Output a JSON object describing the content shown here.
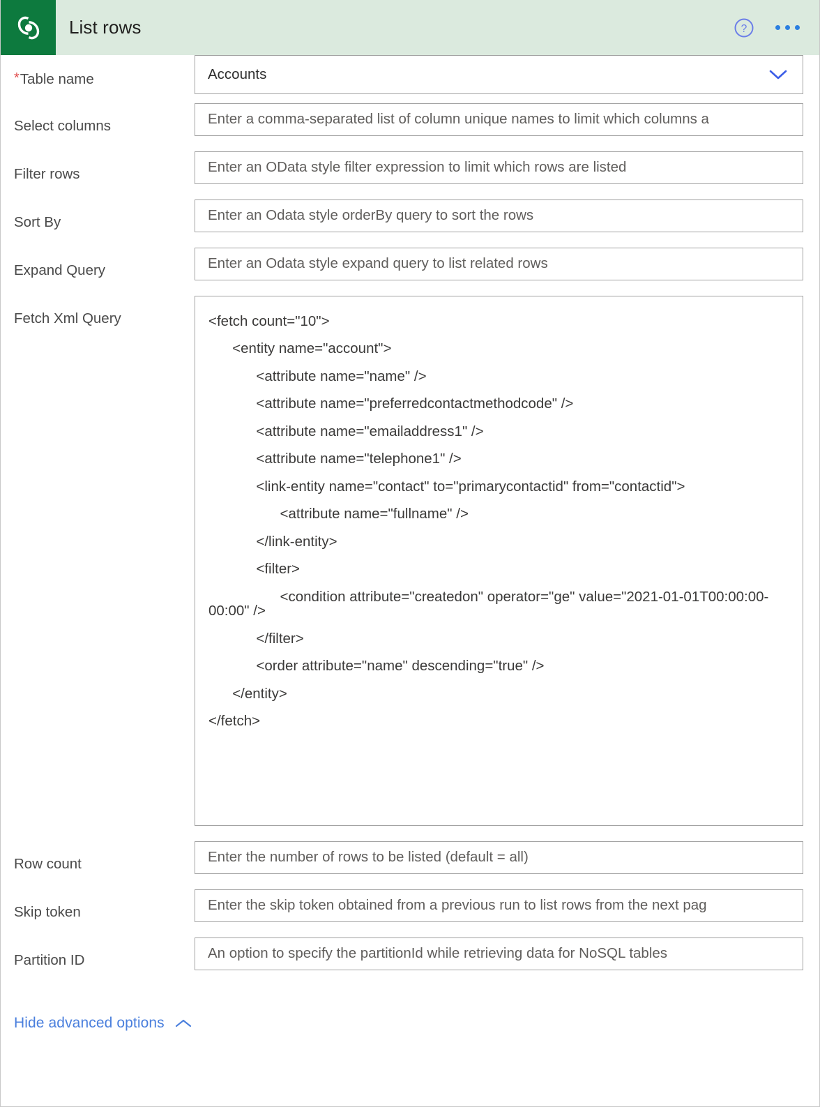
{
  "header": {
    "title": "List rows",
    "logo_name": "dataverse-logo",
    "logo_color": "#0d7a3e",
    "bar_color": "#dbeade",
    "help_label": "?",
    "accent_color": "#2b7fe0"
  },
  "form": {
    "fields": [
      {
        "label": "Table name",
        "required": true,
        "name": "table-name",
        "value": "Accounts",
        "placeholder": "",
        "control": "dropdown"
      },
      {
        "label": "Select columns",
        "required": false,
        "name": "select-columns",
        "value": "",
        "placeholder": "Enter a comma-separated list of column unique names to limit which columns a",
        "control": "text"
      },
      {
        "label": "Filter rows",
        "required": false,
        "name": "filter-rows",
        "value": "",
        "placeholder": "Enter an OData style filter expression to limit which rows are listed",
        "control": "text"
      },
      {
        "label": "Sort By",
        "required": false,
        "name": "sort-by",
        "value": "",
        "placeholder": "Enter an Odata style orderBy query to sort the rows",
        "control": "text"
      },
      {
        "label": "Expand Query",
        "required": false,
        "name": "expand-query",
        "value": "",
        "placeholder": "Enter an Odata style expand query to list related rows",
        "control": "text"
      },
      {
        "label": "Fetch Xml Query",
        "required": false,
        "name": "fetch-xml-query",
        "control": "multiline"
      },
      {
        "label": "Row count",
        "required": false,
        "name": "row-count",
        "value": "",
        "placeholder": "Enter the number of rows to be listed (default = all)",
        "control": "text"
      },
      {
        "label": "Skip token",
        "required": false,
        "name": "skip-token",
        "value": "",
        "placeholder": "Enter the skip token obtained from a previous run to list rows from the next pag",
        "control": "text"
      },
      {
        "label": "Partition ID",
        "required": false,
        "name": "partition-id",
        "value": "",
        "placeholder": "An option to specify the partitionId while retrieving data for NoSQL tables",
        "control": "text"
      }
    ],
    "fetch_xml_lines": [
      "<fetch count=\"10\">",
      "      <entity name=\"account\">",
      "            <attribute name=\"name\" />",
      "            <attribute name=\"preferredcontactmethodcode\" />",
      "            <attribute name=\"emailaddress1\" />",
      "            <attribute name=\"telephone1\" />",
      "            <link-entity name=\"contact\" to=\"primarycontactid\" from=\"contactid\">",
      "                  <attribute name=\"fullname\" />",
      "            </link-entity>",
      "            <filter>",
      "                  <condition attribute=\"createdon\" operator=\"ge\" value=\"2021-01-01T00:00:00-00:00\" />",
      "            </filter>",
      "            <order attribute=\"name\" descending=\"true\" />",
      "      </entity>",
      "</fetch>"
    ]
  },
  "footer": {
    "advanced_options_label": "Hide advanced options"
  }
}
